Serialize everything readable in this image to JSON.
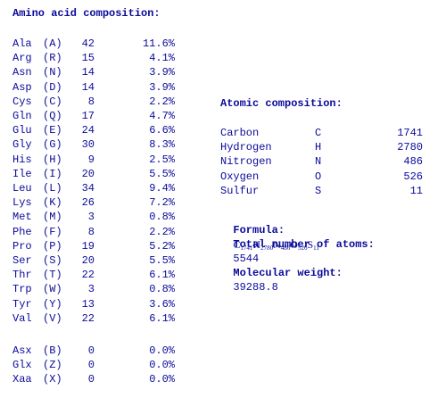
{
  "amino_acid": {
    "heading": "Amino acid composition:",
    "rows": [
      {
        "name": "Ala",
        "code": "(A)",
        "count": "42",
        "percent": "11.6%"
      },
      {
        "name": "Arg",
        "code": "(R)",
        "count": "15",
        "percent": "4.1%"
      },
      {
        "name": "Asn",
        "code": "(N)",
        "count": "14",
        "percent": "3.9%"
      },
      {
        "name": "Asp",
        "code": "(D)",
        "count": "14",
        "percent": "3.9%"
      },
      {
        "name": "Cys",
        "code": "(C)",
        "count": "8",
        "percent": "2.2%"
      },
      {
        "name": "Gln",
        "code": "(Q)",
        "count": "17",
        "percent": "4.7%"
      },
      {
        "name": "Glu",
        "code": "(E)",
        "count": "24",
        "percent": "6.6%"
      },
      {
        "name": "Gly",
        "code": "(G)",
        "count": "30",
        "percent": "8.3%"
      },
      {
        "name": "His",
        "code": "(H)",
        "count": "9",
        "percent": "2.5%"
      },
      {
        "name": "Ile",
        "code": "(I)",
        "count": "20",
        "percent": "5.5%"
      },
      {
        "name": "Leu",
        "code": "(L)",
        "count": "34",
        "percent": "9.4%"
      },
      {
        "name": "Lys",
        "code": "(K)",
        "count": "26",
        "percent": "7.2%"
      },
      {
        "name": "Met",
        "code": "(M)",
        "count": "3",
        "percent": "0.8%"
      },
      {
        "name": "Phe",
        "code": "(F)",
        "count": "8",
        "percent": "2.2%"
      },
      {
        "name": "Pro",
        "code": "(P)",
        "count": "19",
        "percent": "5.2%"
      },
      {
        "name": "Ser",
        "code": "(S)",
        "count": "20",
        "percent": "5.5%"
      },
      {
        "name": "Thr",
        "code": "(T)",
        "count": "22",
        "percent": "6.1%"
      },
      {
        "name": "Trp",
        "code": "(W)",
        "count": "3",
        "percent": "0.8%"
      },
      {
        "name": "Tyr",
        "code": "(Y)",
        "count": "13",
        "percent": "3.6%"
      },
      {
        "name": "Val",
        "code": "(V)",
        "count": "22",
        "percent": "6.1%"
      }
    ],
    "ambiguous_rows": [
      {
        "name": "Asx",
        "code": "(B)",
        "count": "0",
        "percent": "0.0%"
      },
      {
        "name": "Glx",
        "code": "(Z)",
        "count": "0",
        "percent": "0.0%"
      },
      {
        "name": "Xaa",
        "code": "(X)",
        "count": "0",
        "percent": "0.0%"
      }
    ]
  },
  "atomic": {
    "heading": "Atomic composition:",
    "rows": [
      {
        "name": "Carbon",
        "symbol": "C",
        "count": "1741"
      },
      {
        "name": "Hydrogen",
        "symbol": "H",
        "count": "2780"
      },
      {
        "name": "Nitrogen",
        "symbol": "N",
        "count": "486"
      },
      {
        "name": "Oxygen",
        "symbol": "O",
        "count": "526"
      },
      {
        "name": "Sulfur",
        "symbol": "S",
        "count": "11"
      }
    ]
  },
  "formula": {
    "label": "Formula:",
    "parts": [
      {
        "el": "C",
        "n": "1741"
      },
      {
        "el": "H",
        "n": "2780"
      },
      {
        "el": "N",
        "n": "486"
      },
      {
        "el": "O",
        "n": "526"
      },
      {
        "el": "S",
        "n": "11"
      }
    ]
  },
  "total_atoms": {
    "label": "Total number of atoms:",
    "value": "5544"
  },
  "molecular_weight": {
    "label": "Molecular weight:",
    "value": "39288.8"
  }
}
